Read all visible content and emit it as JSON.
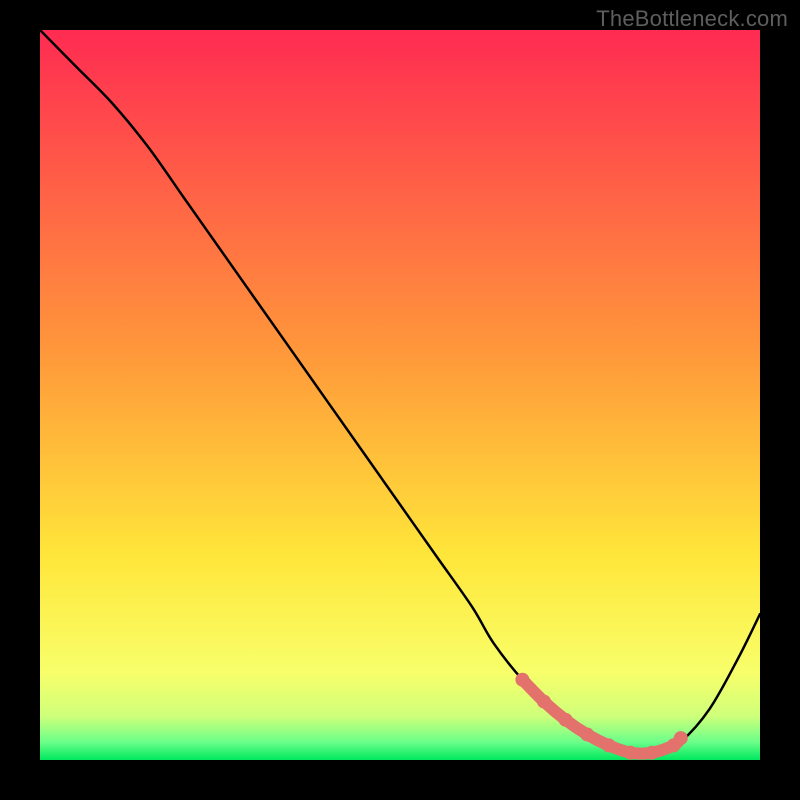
{
  "watermark": "TheBottleneck.com",
  "chart_data": {
    "type": "line",
    "title": "",
    "xlabel": "",
    "ylabel": "",
    "xlim": [
      0,
      100
    ],
    "ylim": [
      0,
      100
    ],
    "gradient_stops": [
      {
        "offset": 0,
        "color": "#ff2b52"
      },
      {
        "offset": 0.45,
        "color": "#ff9a3a"
      },
      {
        "offset": 0.72,
        "color": "#ffe63a"
      },
      {
        "offset": 0.88,
        "color": "#f8ff6a"
      },
      {
        "offset": 0.94,
        "color": "#cfff7a"
      },
      {
        "offset": 0.975,
        "color": "#6cff8a"
      },
      {
        "offset": 1,
        "color": "#00e85e"
      }
    ],
    "series": [
      {
        "name": "curve",
        "color": "#000000",
        "x": [
          0,
          5,
          10,
          15,
          20,
          25,
          30,
          35,
          40,
          45,
          50,
          55,
          60,
          63,
          67,
          72,
          77,
          82,
          86,
          89,
          93,
          97,
          100
        ],
        "y": [
          100,
          95,
          90,
          84,
          77,
          70,
          63,
          56,
          49,
          42,
          35,
          28,
          21,
          16,
          11,
          6,
          2.5,
          1,
          1,
          2.5,
          7,
          14,
          20
        ]
      }
    ],
    "highlight": {
      "color": "#e2726b",
      "x": [
        67,
        70,
        73,
        76,
        79,
        82,
        85,
        88,
        89
      ],
      "y": [
        11,
        8,
        5.5,
        3.5,
        2,
        1,
        1,
        2,
        3
      ]
    }
  }
}
